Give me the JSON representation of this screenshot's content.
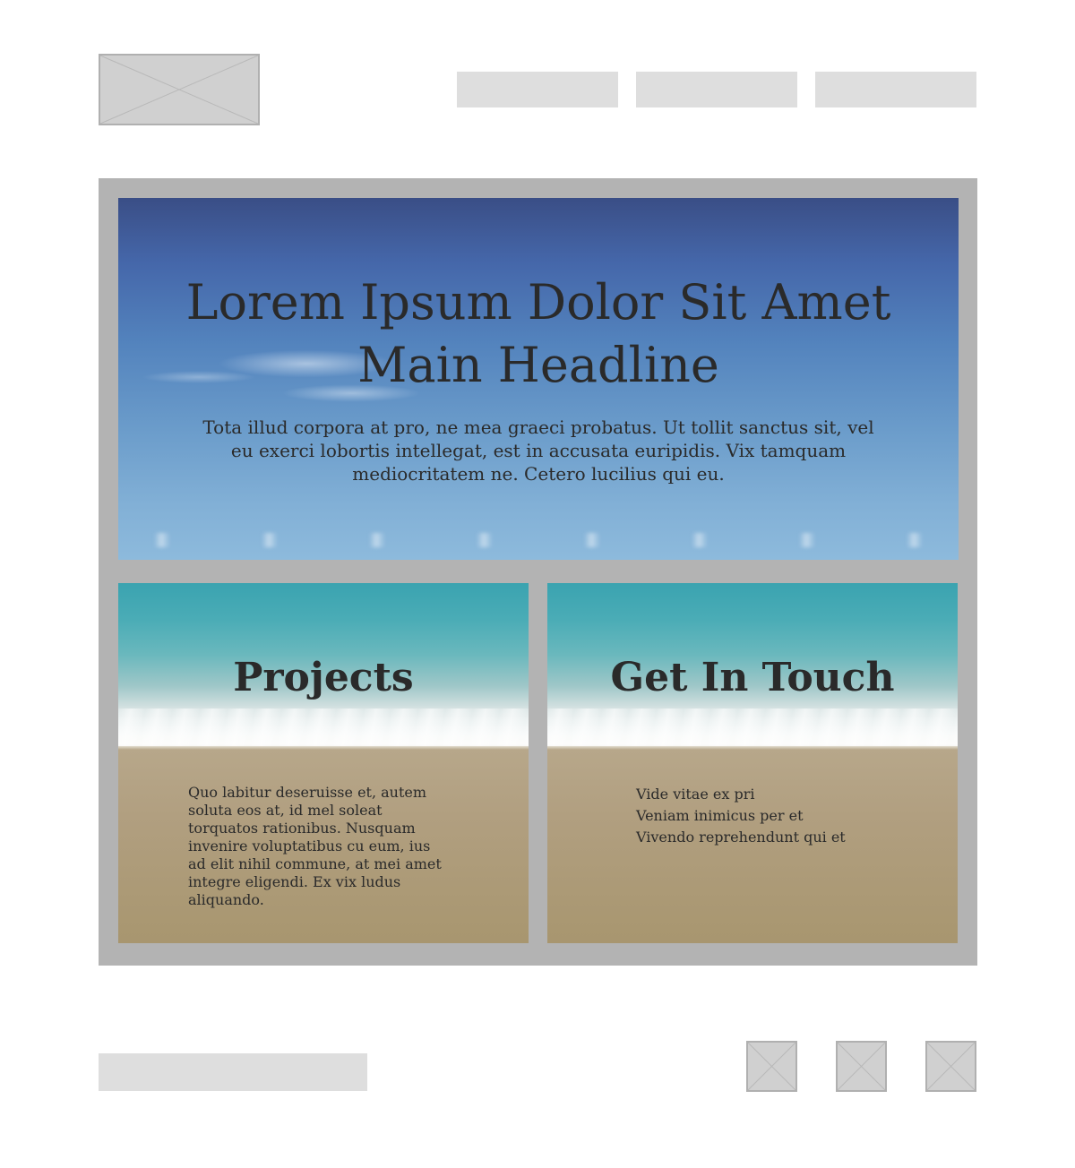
{
  "header": {
    "logo_icon": "image-placeholder-icon",
    "nav": [
      "",
      "",
      ""
    ]
  },
  "hero": {
    "title_line1": "Lorem Ipsum Dolor Sit Amet",
    "title_line2": "Main Headline",
    "body": "Tota illud corpora at pro, ne mea graeci probatus. Ut tollit sanctus sit, vel eu exerci lobortis intellegat, est in accusata euripidis. Vix tamquam mediocritatem ne. Cetero lucilius qui eu."
  },
  "projects": {
    "title": "Projects",
    "body": "Quo labitur deseruisse et, autem soluta eos at, id mel soleat torquatos rationibus. Nusquam invenire voluptatibus cu eum, ius ad elit nihil commune, at mei amet integre eligendi. Ex vix ludus aliquando."
  },
  "contact": {
    "title": "Get In Touch",
    "lines": [
      "Vide vitae ex pri",
      "Veniam inimicus per et",
      "Vivendo reprehendunt qui et"
    ]
  },
  "footer": {
    "social_icons": [
      "image-placeholder-icon",
      "image-placeholder-icon",
      "image-placeholder-icon"
    ]
  },
  "colors": {
    "placeholder_fill": "#d0d0d0",
    "placeholder_border": "#b0b0b0",
    "nav_bar": "#dedede",
    "frame": "#b3b3b3",
    "text": "#2a2a2a"
  }
}
